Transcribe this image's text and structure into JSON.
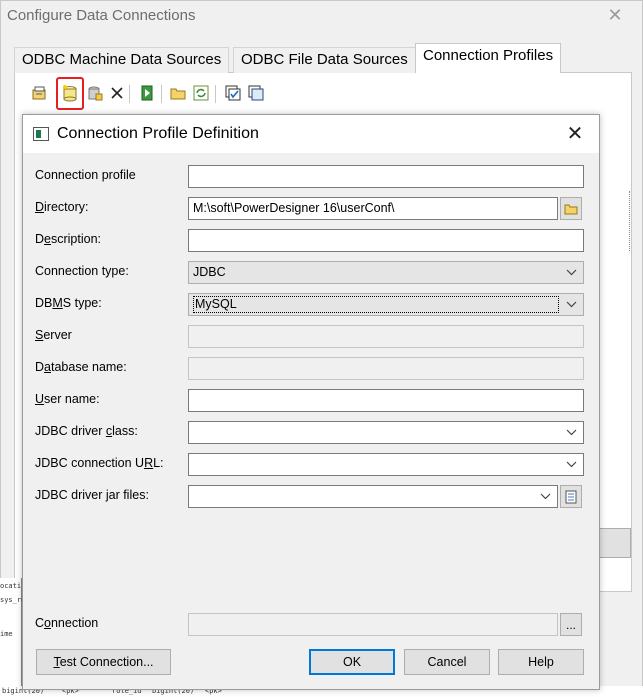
{
  "outer_dialog": {
    "title": "Configure Data Connections",
    "close_glyph": "✕",
    "tabs": [
      {
        "label": "ODBC Machine Data Sources",
        "active": false
      },
      {
        "label": "ODBC File Data Sources",
        "active": false
      },
      {
        "label": "Connection Profiles",
        "active": true
      }
    ],
    "toolbar_icons": [
      "properties-icon",
      "new-profile-icon",
      "add-profile-icon",
      "delete-icon",
      "test-connection-icon",
      "open-folder-icon",
      "refresh-icon",
      "check-all-icon",
      "uncheck-all-icon"
    ],
    "highlight_color": "#e81f1f"
  },
  "dialog": {
    "title": "Connection Profile Definition",
    "close_glyph": "✕",
    "fields": {
      "connection_profile": {
        "label_pre": "Connection profile",
        "mnemonic": "",
        "label_post": "",
        "value": ""
      },
      "directory": {
        "label_pre": "",
        "mnemonic": "D",
        "label_post": "irectory:",
        "value": "M:\\soft\\PowerDesigner 16\\userConf\\"
      },
      "description": {
        "label_pre": "D",
        "mnemonic": "e",
        "label_post": "scription:",
        "value": ""
      },
      "connection_type": {
        "label_pre": "Connection type:",
        "mnemonic": "",
        "label_post": "",
        "value": "JDBC"
      },
      "dbms_type": {
        "label_pre": "DB",
        "mnemonic": "M",
        "label_post": "S type:",
        "value": "MySQL"
      },
      "server": {
        "label_pre": "",
        "mnemonic": "S",
        "label_post": "erver",
        "value": ""
      },
      "database_name": {
        "label_pre": "D",
        "mnemonic": "a",
        "label_post": "tabase name:",
        "value": ""
      },
      "user_name": {
        "label_pre": "",
        "mnemonic": "U",
        "label_post": "ser name:",
        "value": ""
      },
      "jdbc_driver_class": {
        "label_pre": "JDBC driver ",
        "mnemonic": "c",
        "label_post": "lass:",
        "value": ""
      },
      "jdbc_connection_url": {
        "label_pre": "JDBC connection U",
        "mnemonic": "R",
        "label_post": "L:",
        "value": ""
      },
      "jdbc_driver_jar_files": {
        "label_pre": "JDBC driver ",
        "mnemonic": "j",
        "label_post": "ar files:",
        "value": ""
      },
      "connection": {
        "label_pre": "C",
        "mnemonic": "o",
        "label_post": "nnection",
        "value": ""
      }
    },
    "ellipsis_label": "...",
    "buttons": {
      "test_connection": {
        "pre": "",
        "mnemonic": "T",
        "post": "est Connection..."
      },
      "ok": "OK",
      "cancel": "Cancel",
      "help": "Help"
    },
    "default_button_color": "#0078d7"
  },
  "background_text": {
    "side": [
      "ocati",
      "sys_ro",
      "ime"
    ],
    "bottom": [
      "bigint(20)",
      "<pk>",
      "role_id",
      "bigint(20)",
      "<pk>"
    ]
  }
}
